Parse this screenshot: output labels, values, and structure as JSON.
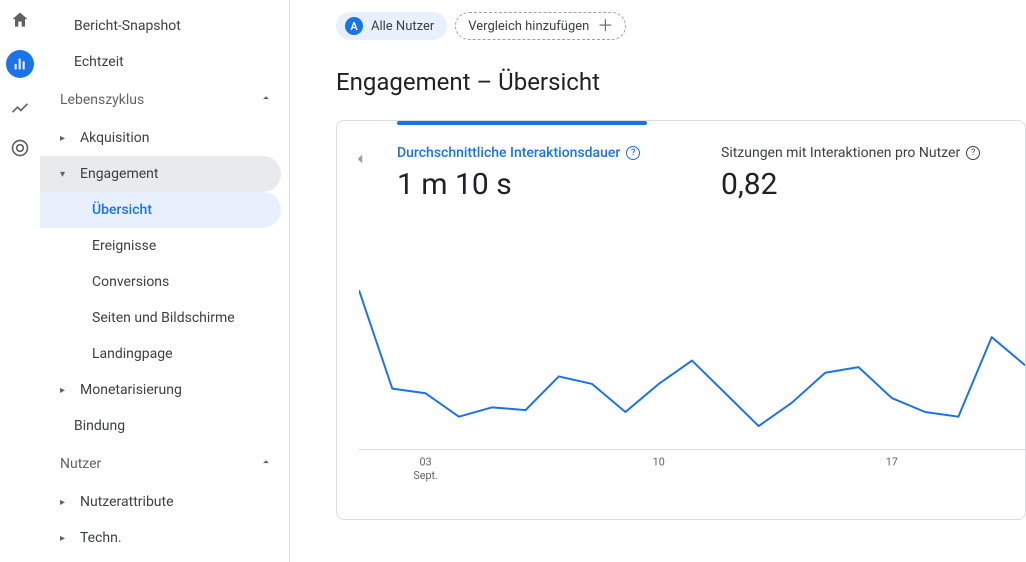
{
  "rail": {
    "items": [
      {
        "name": "home-icon"
      },
      {
        "name": "reports-icon",
        "active": true
      },
      {
        "name": "explore-icon"
      },
      {
        "name": "advertising-icon"
      }
    ]
  },
  "sidebar": {
    "top_items": [
      {
        "label": "Bericht-Snapshot"
      },
      {
        "label": "Echtzeit"
      }
    ],
    "sections": [
      {
        "label": "Lebenszyklus",
        "expanded": true,
        "items": [
          {
            "label": "Akquisition",
            "expandable": true
          },
          {
            "label": "Engagement",
            "expandable": true,
            "open": true,
            "children": [
              {
                "label": "Übersicht",
                "selected": true
              },
              {
                "label": "Ereignisse"
              },
              {
                "label": "Conversions"
              },
              {
                "label": "Seiten und Bildschirme"
              },
              {
                "label": "Landingpage"
              }
            ]
          },
          {
            "label": "Monetarisierung",
            "expandable": true
          },
          {
            "label": "Bindung",
            "expandable": false
          }
        ]
      },
      {
        "label": "Nutzer",
        "expanded": true,
        "items": [
          {
            "label": "Nutzerattribute",
            "expandable": true
          },
          {
            "label": "Techn.",
            "expandable": true
          }
        ]
      }
    ]
  },
  "header": {
    "segment_badge": "A",
    "segment_label": "Alle Nutzer",
    "compare_label": "Vergleich hinzufügen"
  },
  "page": {
    "title": "Engagement – Übersicht"
  },
  "metrics": [
    {
      "label": "Durchschnittliche Interaktionsdauer",
      "value": "1 m 10 s",
      "active": true
    },
    {
      "label": "Sitzungen mit Interaktionen pro Nutzer",
      "value": "0,82",
      "active": false
    }
  ],
  "chart_data": {
    "type": "line",
    "xlabel": "",
    "ylabel": "",
    "x_month_label": "Sept.",
    "ticks": [
      "03",
      "10",
      "17"
    ],
    "x": [
      1,
      2,
      3,
      4,
      5,
      6,
      7,
      8,
      9,
      10,
      11,
      12,
      13,
      14,
      15,
      16,
      17,
      18,
      19,
      20,
      21
    ],
    "series": [
      {
        "name": "Durchschnittliche Interaktionsdauer",
        "values": [
          170,
          65,
          60,
          35,
          45,
          42,
          78,
          70,
          40,
          70,
          95,
          60,
          25,
          50,
          82,
          88,
          55,
          40,
          35,
          120,
          90
        ]
      }
    ],
    "ylim": [
      0,
      180
    ]
  }
}
